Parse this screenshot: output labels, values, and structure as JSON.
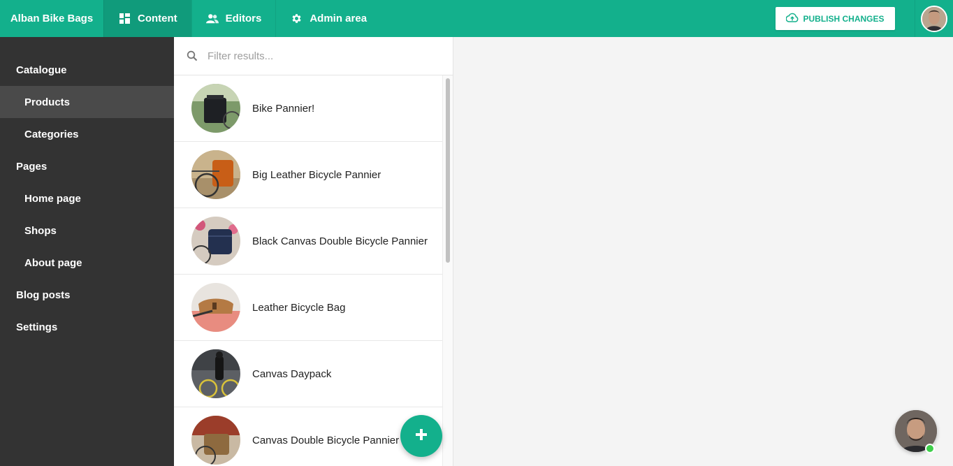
{
  "header": {
    "brand": "Alban Bike Bags",
    "tabs": [
      {
        "label": "Content",
        "icon": "grid-icon"
      },
      {
        "label": "Editors",
        "icon": "users-icon"
      },
      {
        "label": "Admin area",
        "icon": "gear-icon"
      }
    ],
    "publish_label": "PUBLISH CHANGES",
    "colors": {
      "accent": "#13b08c",
      "accent_dark": "#109b7b"
    }
  },
  "sidebar": {
    "items": [
      {
        "label": "Catalogue",
        "level": 0
      },
      {
        "label": "Products",
        "level": 1,
        "active": true
      },
      {
        "label": "Categories",
        "level": 1
      },
      {
        "label": "Pages",
        "level": 0
      },
      {
        "label": "Home page",
        "level": 1
      },
      {
        "label": "Shops",
        "level": 1
      },
      {
        "label": "About page",
        "level": 1
      },
      {
        "label": "Blog posts",
        "level": 0
      },
      {
        "label": "Settings",
        "level": 0
      }
    ]
  },
  "list": {
    "search_placeholder": "Filter results...",
    "items": [
      {
        "label": "Bike Pannier!"
      },
      {
        "label": "Big Leather Bicycle Pannier"
      },
      {
        "label": "Black Canvas Double Bicycle Pannier"
      },
      {
        "label": "Leather Bicycle Bag"
      },
      {
        "label": "Canvas Daypack"
      },
      {
        "label": "Canvas Double Bicycle Pannier"
      }
    ]
  }
}
